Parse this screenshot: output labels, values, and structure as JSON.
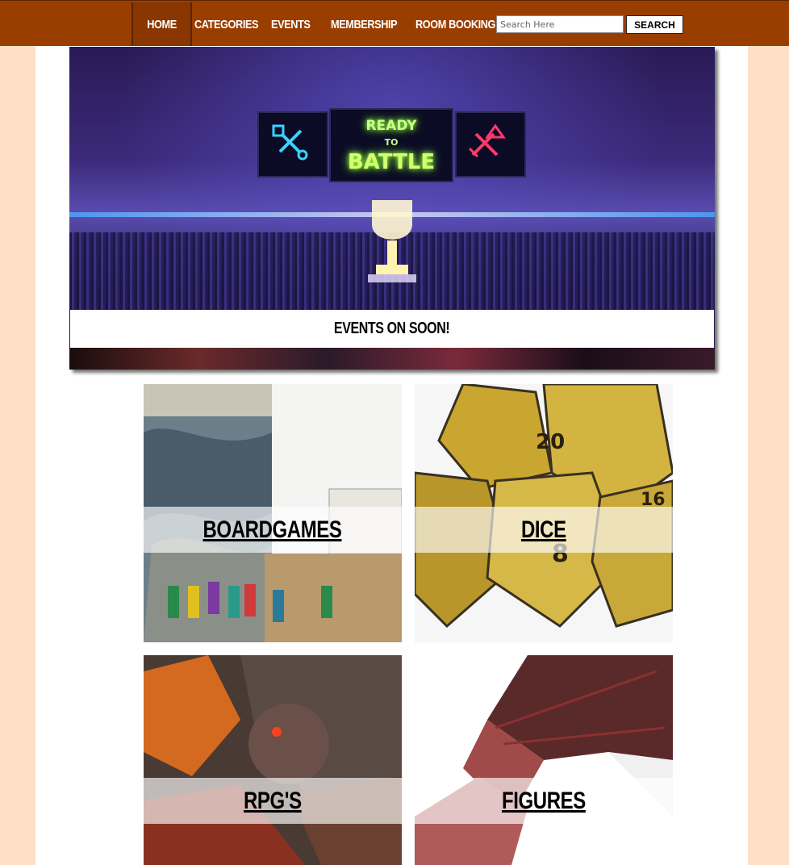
{
  "nav": {
    "items": [
      {
        "label": "Home"
      },
      {
        "label": "Categories"
      },
      {
        "label": "Events"
      },
      {
        "label": "Membership"
      },
      {
        "label": "Room Booking"
      }
    ],
    "search_placeholder": "Search Here",
    "search_button": "Search"
  },
  "hero": {
    "screen_top": "READY",
    "screen_mid": "TO",
    "screen_bottom": "BATTLE",
    "caption": "Events on soon!"
  },
  "categories": [
    {
      "label": "Boardgames"
    },
    {
      "label": "Dice"
    },
    {
      "label": "RPG's"
    },
    {
      "label": "Figures"
    }
  ],
  "colors": {
    "nav_bg": "#9a3e00",
    "page_bg": "#ffe0c6",
    "content_bg": "#ffffff"
  }
}
